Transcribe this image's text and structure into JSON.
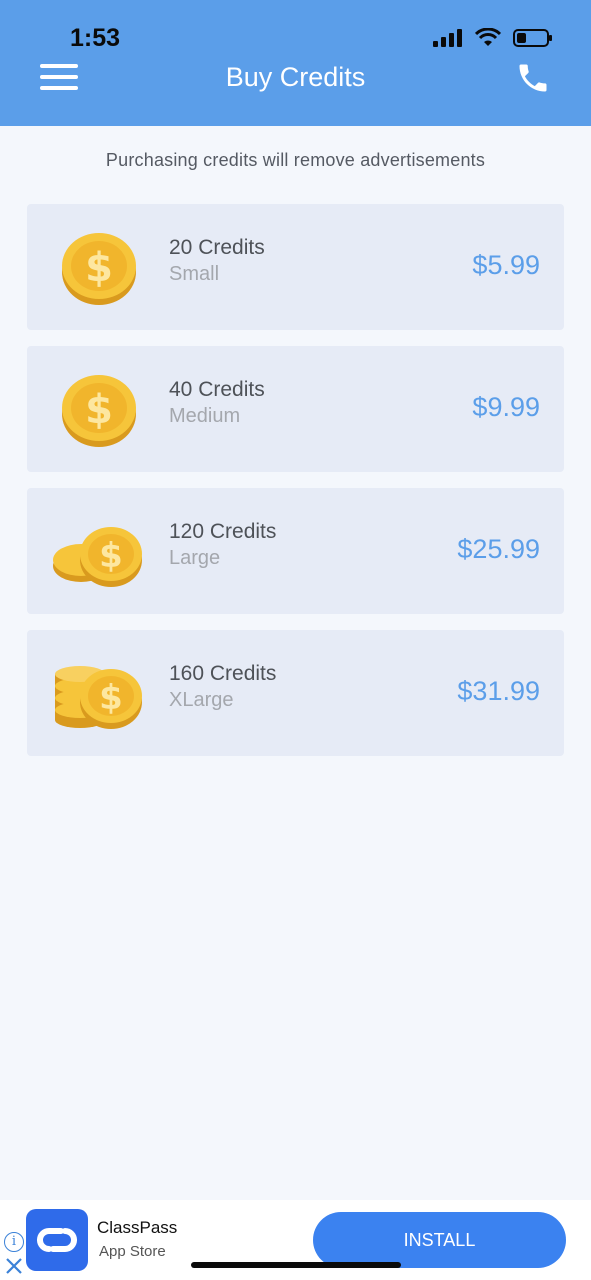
{
  "status_bar": {
    "time": "1:53"
  },
  "header": {
    "title": "Buy Credits",
    "menu_icon": "hamburger-menu-icon",
    "call_icon": "phone-icon"
  },
  "notice": "Purchasing credits will remove advertisements",
  "packages": [
    {
      "name": "20 Credits",
      "size": "Small",
      "price": "$5.99",
      "icon": "single-coin-icon"
    },
    {
      "name": "40 Credits",
      "size": "Medium",
      "price": "$9.99",
      "icon": "single-coin-icon"
    },
    {
      "name": "120 Credits",
      "size": "Large",
      "price": "$25.99",
      "icon": "two-coins-icon"
    },
    {
      "name": "160 Credits",
      "size": "XLarge",
      "price": "$31.99",
      "icon": "coin-stack-icon"
    }
  ],
  "ad": {
    "app_name": "ClassPass",
    "store": "App Store",
    "install_label": "INSTALL"
  },
  "colors": {
    "header": "#5b9ee9",
    "price": "#5b9ee9",
    "card": "#e6ebf6",
    "install": "#3b82f0"
  }
}
